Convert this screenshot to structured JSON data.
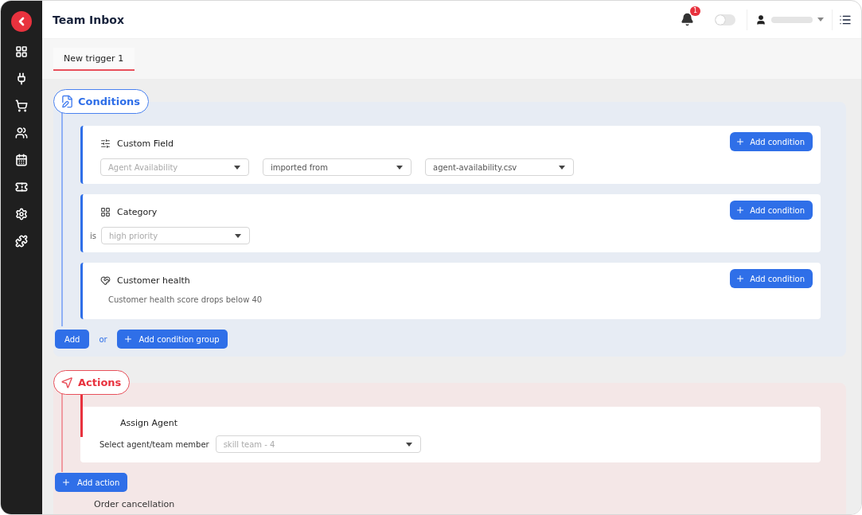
{
  "header": {
    "title": "Team Inbox",
    "notification_count": "1",
    "toggle": {
      "on": false
    }
  },
  "tabs": [
    {
      "label": "New trigger 1",
      "selected": true
    }
  ],
  "conditions": {
    "title": "Conditions",
    "items": [
      {
        "kind": "dropdowns",
        "title": "Custom Field",
        "dropdowns": [
          {
            "placeholder": "Agent Availability"
          },
          {
            "value": "imported from"
          },
          {
            "value": "agent-availability.csv"
          }
        ],
        "button": "Add condition"
      },
      {
        "kind": "dropdowns",
        "title": "Category",
        "prefix": "is",
        "dropdowns": [
          {
            "placeholder": "high priority"
          }
        ],
        "button": "Add condition"
      },
      {
        "kind": "text",
        "title": "Customer health",
        "text": "Customer health score drops below 40",
        "button": "Add condition"
      }
    ],
    "add_button": "Add",
    "or_label": "or",
    "group_button": "Add condition group"
  },
  "actions": {
    "title": "Actions",
    "items": [
      {
        "title": "Assign Agent",
        "field_label": "Select agent/team member",
        "dropdown": {
          "placeholder": "skill team - 4"
        }
      }
    ],
    "add_button": "Add action",
    "next_title": "Order cancellation"
  }
}
